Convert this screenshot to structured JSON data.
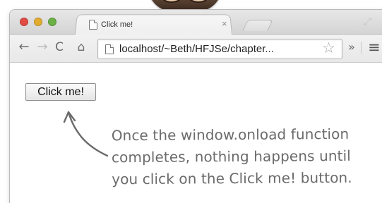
{
  "browser": {
    "tab": {
      "title": "Click me!",
      "close_label": "×"
    },
    "toolbar": {
      "back_label": "←",
      "forward_label": "→",
      "reload_label": "C",
      "home_label": "⌂",
      "url": "localhost/~Beth/HFJSe/chapter...",
      "bookmark_label": "☆",
      "extensions_label": "»",
      "menu_label": "≡"
    }
  },
  "page": {
    "button_label": "Click me!"
  },
  "annotation": {
    "lines": [
      "Once the window.onload function",
      "completes, nothing happens until",
      "you click on the Click me! button."
    ]
  },
  "icons": {
    "tab_page": "page-icon",
    "url_page": "page-icon",
    "bookmark": "star-icon",
    "menu": "hamburger-menu-icon",
    "fullscreen": "fullscreen-icon"
  },
  "colors": {
    "annotation": "#6b6b6b",
    "traffic_red": "#e24b42",
    "traffic_yellow": "#e3ac2f",
    "traffic_green": "#6bb146"
  }
}
